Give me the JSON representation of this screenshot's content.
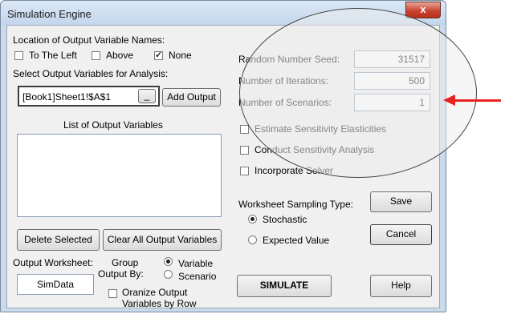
{
  "window": {
    "title": "Simulation Engine",
    "close_label": "x",
    "top_glyph": "'"
  },
  "location_group": {
    "label": "Location of Output Variable Names:",
    "options": [
      {
        "label": "To The Left",
        "checked": false
      },
      {
        "label": "Above",
        "checked": false
      },
      {
        "label": "None",
        "checked": true
      }
    ]
  },
  "select_output": {
    "label": "Select Output Variables for Analysis:",
    "value": "[Book1]Sheet1!$A$1",
    "collapse_label": "_",
    "add_button": "Add Output"
  },
  "output_list": {
    "label": "List of Output Variables",
    "items": []
  },
  "list_buttons": {
    "delete": "Delete Selected",
    "clear": "Clear All Output Variables"
  },
  "output_worksheet": {
    "label": "Output Worksheet:",
    "value": "SimData"
  },
  "group_by": {
    "label_line1": "Group",
    "label_line2": "Output By:",
    "options": [
      {
        "label": "Variable",
        "selected": true
      },
      {
        "label": "Scenario",
        "selected": false
      }
    ]
  },
  "organize": {
    "line1": "Oranize Output",
    "line2": "Variables by Row",
    "checked": false
  },
  "params": {
    "seed_label": "Random Number Seed:",
    "seed_value": "31517",
    "iterations_label": "Number of Iterations:",
    "iterations_value": "500",
    "scenarios_label": "Number of Scenarios:",
    "scenarios_value": "1"
  },
  "options": {
    "elasticities": "Estimate Sensitivity Elasticities",
    "sensitivity": "Conduct Sensitivity Analysis",
    "solver": "Incorporate Solver"
  },
  "sampling": {
    "label": "Worksheet Sampling Type:",
    "stochastic": "Stochastic",
    "expected": "Expected Value",
    "selected": "Stochastic"
  },
  "buttons": {
    "save": "Save",
    "cancel": "Cancel",
    "simulate": "SIMULATE",
    "help": "Help"
  },
  "annotation": {
    "arrow_color": "#e8231f"
  },
  "colors": {
    "titlebar": "#c9daec",
    "close": "#c9442f"
  }
}
